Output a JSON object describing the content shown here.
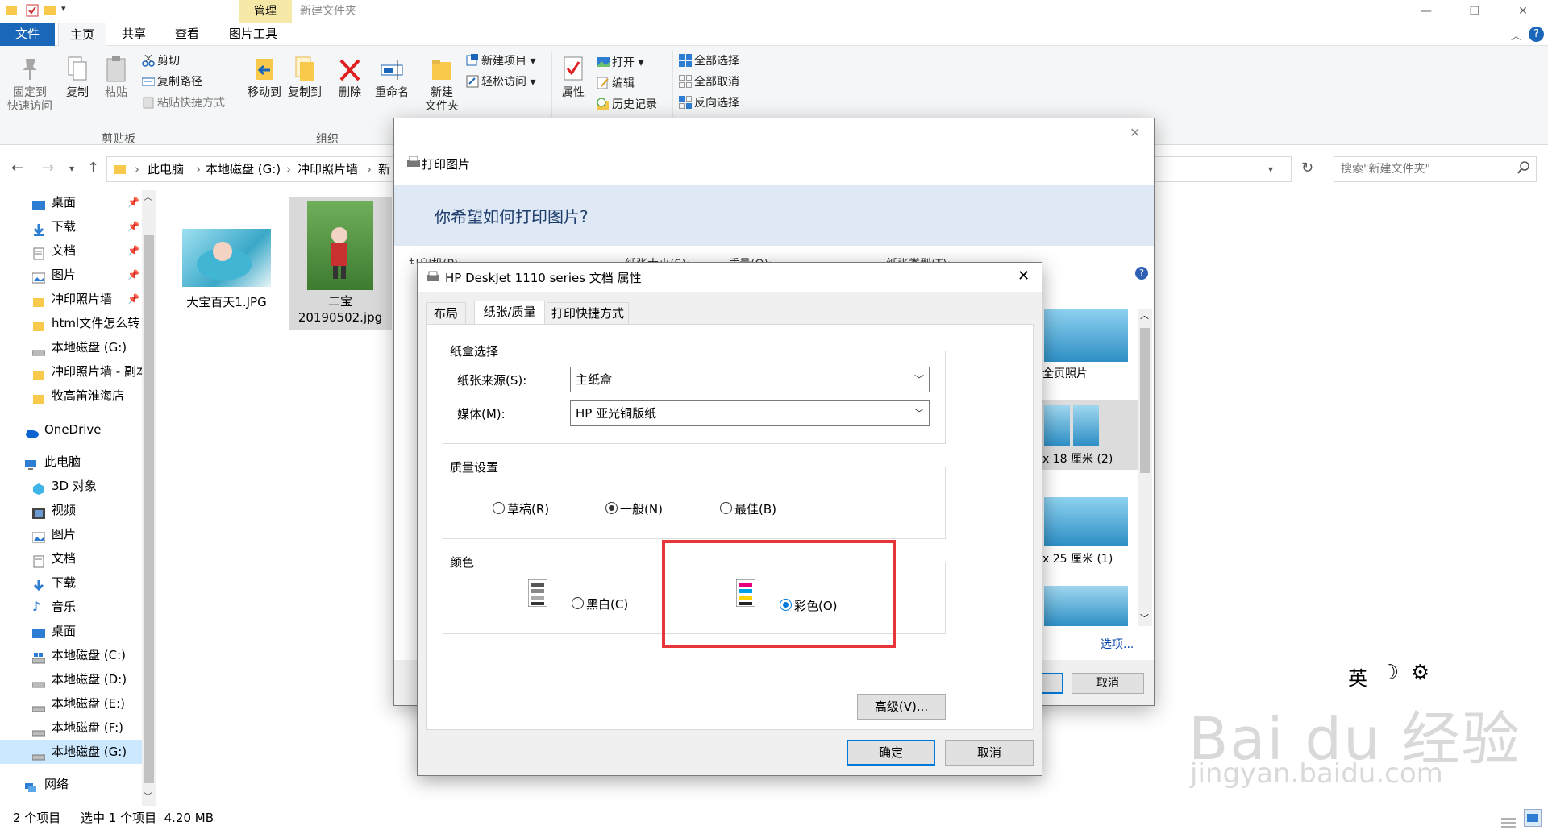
{
  "window": {
    "title": "新建文件夹",
    "context_tab": "管理",
    "controls": {
      "minimize": "—",
      "maximize": "❐",
      "close": "✕"
    }
  },
  "ribbon_tabs": [
    "文件",
    "主页",
    "共享",
    "查看",
    "图片工具"
  ],
  "ribbon": {
    "clipboard": {
      "pin_label": "固定到\n快速访问",
      "copy_label": "复制",
      "paste_label": "粘贴",
      "cut_label": "剪切",
      "copy_path_label": "复制路径",
      "paste_shortcut_label": "粘贴快捷方式",
      "group_label": "剪贴板"
    },
    "organize": {
      "move_to_label": "移动到",
      "copy_to_label": "复制到",
      "delete_label": "删除",
      "rename_label": "重命名",
      "group_label": "组织"
    },
    "new": {
      "new_folder_label": "新建\n文件夹",
      "new_item_label": "新建项目 ▾",
      "easy_access_label": "轻松访问 ▾"
    },
    "open": {
      "properties_label": "属性",
      "open_label": "打开 ▾",
      "edit_label": "编辑",
      "history_label": "历史记录"
    },
    "select": {
      "select_all_label": "全部选择",
      "select_none_label": "全部取消",
      "invert_label": "反向选择"
    }
  },
  "address": {
    "crumbs": [
      "此电脑",
      "本地磁盘 (G:)",
      "冲印照片墙",
      "新"
    ],
    "search_placeholder": "搜索\"新建文件夹\""
  },
  "sidebar": {
    "quick": [
      {
        "label": "桌面",
        "icon": "desktop-icon"
      },
      {
        "label": "下载",
        "icon": "download-icon"
      },
      {
        "label": "文档",
        "icon": "document-icon"
      },
      {
        "label": "图片",
        "icon": "picture-icon"
      },
      {
        "label": "冲印照片墙",
        "icon": "folder-icon"
      },
      {
        "label": "html文件怎么转",
        "icon": "folder-icon"
      },
      {
        "label": "本地磁盘 (G:)",
        "icon": "drive-icon"
      },
      {
        "label": "冲印照片墙 - 副本",
        "icon": "folder-icon"
      },
      {
        "label": "牧高笛淮海店",
        "icon": "folder-icon"
      }
    ],
    "onedrive": "OneDrive",
    "this_pc": "此电脑",
    "pc_items": [
      {
        "label": "3D 对象",
        "icon": "3d-objects-icon"
      },
      {
        "label": "视频",
        "icon": "video-icon"
      },
      {
        "label": "图片",
        "icon": "picture-icon"
      },
      {
        "label": "文档",
        "icon": "document-icon"
      },
      {
        "label": "下载",
        "icon": "download-icon"
      },
      {
        "label": "音乐",
        "icon": "music-icon"
      },
      {
        "label": "桌面",
        "icon": "desktop-icon"
      },
      {
        "label": "本地磁盘 (C:)",
        "icon": "drive-icon"
      },
      {
        "label": "本地磁盘 (D:)",
        "icon": "drive-icon"
      },
      {
        "label": "本地磁盘 (E:)",
        "icon": "drive-icon"
      },
      {
        "label": "本地磁盘 (F:)",
        "icon": "drive-icon"
      },
      {
        "label": "本地磁盘 (G:)",
        "icon": "drive-icon"
      }
    ],
    "network": "网络"
  },
  "files": [
    {
      "name": "大宝百天1.JPG"
    },
    {
      "name": "二宝\n20190502.jpg"
    }
  ],
  "status": {
    "count": "2 个项目",
    "selection": "选中 1 个项目  4.20 MB"
  },
  "print_dialog": {
    "title": "打印图片",
    "question": "你希望如何打印图片?",
    "printer_label": "打印机(P):",
    "paper_size_label": "纸张大小(S):",
    "quality_label": "质量(Q):",
    "paper_type_label": "纸张类型(T):",
    "layouts": [
      "全页照片",
      "x 18 厘米 (2)",
      "x 25 厘米 (1)"
    ],
    "options_link": "选项...",
    "cancel": "取消"
  },
  "props_dialog": {
    "title": "HP DeskJet 1110 series 文档 属性",
    "tabs": [
      "布局",
      "纸张/质量",
      "打印快捷方式"
    ],
    "tray_group": "纸盒选择",
    "source_label": "纸张来源(S):",
    "source_value": "主纸盒",
    "media_label": "媒体(M):",
    "media_value": "HP 亚光铜版纸",
    "quality_group": "质量设置",
    "quality_options": [
      "草稿(R)",
      "一般(N)",
      "最佳(B)"
    ],
    "quality_selected": "一般(N)",
    "color_group": "颜色",
    "color_options": [
      "黑白(C)",
      "彩色(O)"
    ],
    "color_selected": "彩色(O)",
    "advanced": "高级(V)...",
    "ok": "确定",
    "cancel": "取消",
    "highlight_color": "#e8353a"
  },
  "ime": {
    "lang": "英",
    "moon_icon": "moon-icon",
    "gear_icon": "gear-icon"
  },
  "watermark": {
    "brand": "Bai du 经验",
    "url": "jingyan.baidu.com"
  }
}
